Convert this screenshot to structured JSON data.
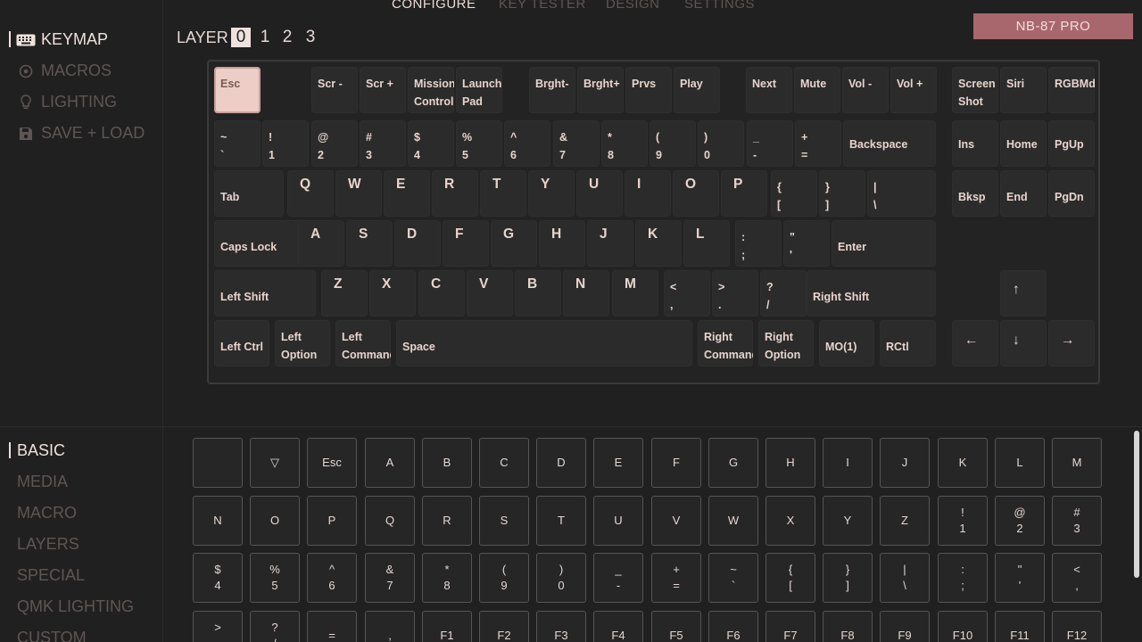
{
  "nav": {
    "tabs": [
      "CONFIGURE",
      "KEY TESTER",
      "DESIGN",
      "SETTINGS"
    ],
    "active": 0
  },
  "device": {
    "name": "NB-87 PRO"
  },
  "colors": {
    "accent": "#efe2de",
    "badge": "#a8676c",
    "selected_key": "#eccec7",
    "background": "#202020"
  },
  "menu": {
    "items": [
      {
        "label": "KEYMAP",
        "icon": "keyboard-icon",
        "active": true
      },
      {
        "label": "MACROS",
        "icon": "target-icon",
        "active": false
      },
      {
        "label": "LIGHTING",
        "icon": "lightbulb-icon",
        "active": false
      },
      {
        "label": "SAVE + LOAD",
        "icon": "floppy-icon",
        "active": false
      }
    ]
  },
  "layer": {
    "label": "LAYER",
    "options": [
      "0",
      "1",
      "2",
      "3"
    ],
    "active": 0
  },
  "keyboard": {
    "selected_key": "Esc",
    "rows": [
      [
        "Esc",
        "",
        "Scr -",
        "Scr +",
        "Mission\nControl",
        "Launch\nPad",
        "Brght-",
        "Brght+",
        "Prvs",
        "Play",
        "Next",
        "Mute",
        "Vol -",
        "Vol +",
        "Screen\nShot",
        "Siri",
        "RGBMd+"
      ],
      [
        "~\n`",
        "!\n1",
        "@\n2",
        "#\n3",
        "$\n4",
        "%\n5",
        "^\n6",
        "&\n7",
        "*\n8",
        "(\n9",
        ")\n0",
        "_\n-",
        "+\n=",
        "Backspace",
        "Ins",
        "Home",
        "PgUp"
      ],
      [
        "Tab",
        "Q",
        "W",
        "E",
        "R",
        "T",
        "Y",
        "U",
        "I",
        "O",
        "P",
        "{\n[",
        "}\n]",
        "|\n\\",
        "Bksp",
        "End",
        "PgDn"
      ],
      [
        "Caps Lock",
        "A",
        "S",
        "D",
        "F",
        "G",
        "H",
        "J",
        "K",
        "L",
        ":\n;",
        "\"\n'",
        "Enter"
      ],
      [
        "Left Shift",
        "Z",
        "X",
        "C",
        "V",
        "B",
        "N",
        "M",
        "<\n,",
        ">\n.",
        "?\n/",
        "Right Shift",
        "↑"
      ],
      [
        "Left Ctrl",
        "Left\nOption",
        "Left\nCommand",
        "Space",
        "Right\nCommand",
        "Right\nOption",
        "MO(1)",
        "RCtl",
        "←",
        "↓",
        "→"
      ]
    ]
  },
  "categories": {
    "items": [
      "BASIC",
      "MEDIA",
      "MACRO",
      "LAYERS",
      "SPECIAL",
      "QMK LIGHTING",
      "CUSTOM"
    ],
    "active": 0
  },
  "basic_keys": [
    "",
    "▽",
    "Esc",
    "A",
    "B",
    "C",
    "D",
    "E",
    "F",
    "G",
    "H",
    "I",
    "J",
    "K",
    "L",
    "M",
    "N",
    "O",
    "P",
    "Q",
    "R",
    "S",
    "T",
    "U",
    "V",
    "W",
    "X",
    "Y",
    "Z",
    "!\n1",
    "@\n2",
    "#\n3",
    "$\n4",
    "%\n5",
    "^\n6",
    "&\n7",
    "*\n8",
    "(\n9",
    ")\n0",
    "_\n-",
    "+\n=",
    "~\n`",
    "{\n[",
    "}\n]",
    "|\n\\",
    ":\n;",
    "\"\n'",
    "<\n,",
    ">\n.",
    "?\n/",
    "=",
    ",",
    "F1",
    "F2",
    "F3",
    "F4",
    "F5",
    "F6",
    "F7",
    "F8",
    "F9",
    "F10",
    "F11",
    "F12"
  ]
}
